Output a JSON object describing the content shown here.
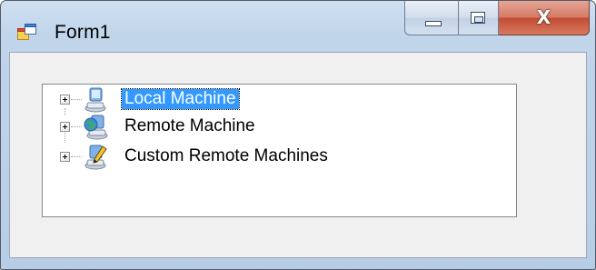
{
  "window": {
    "title": "Form1",
    "icon": "windows-form-icon"
  },
  "caption_buttons": {
    "minimize": "minimize-icon",
    "maximize": "maximize-icon",
    "close": "close-icon",
    "close_glyph": "X"
  },
  "tree": {
    "selected": "Local Machine",
    "nodes": [
      {
        "label": "Local Machine",
        "icon": "computer-icon",
        "expander": "+"
      },
      {
        "label": "Remote Machine",
        "icon": "globe-computer-icon",
        "expander": "+"
      },
      {
        "label": "Custom Remote Machines",
        "icon": "computer-pencil-icon",
        "expander": "+"
      }
    ]
  },
  "colors": {
    "selection": "#3399ff",
    "close_button": "#c44c34",
    "frame": "#bcd1e9"
  }
}
